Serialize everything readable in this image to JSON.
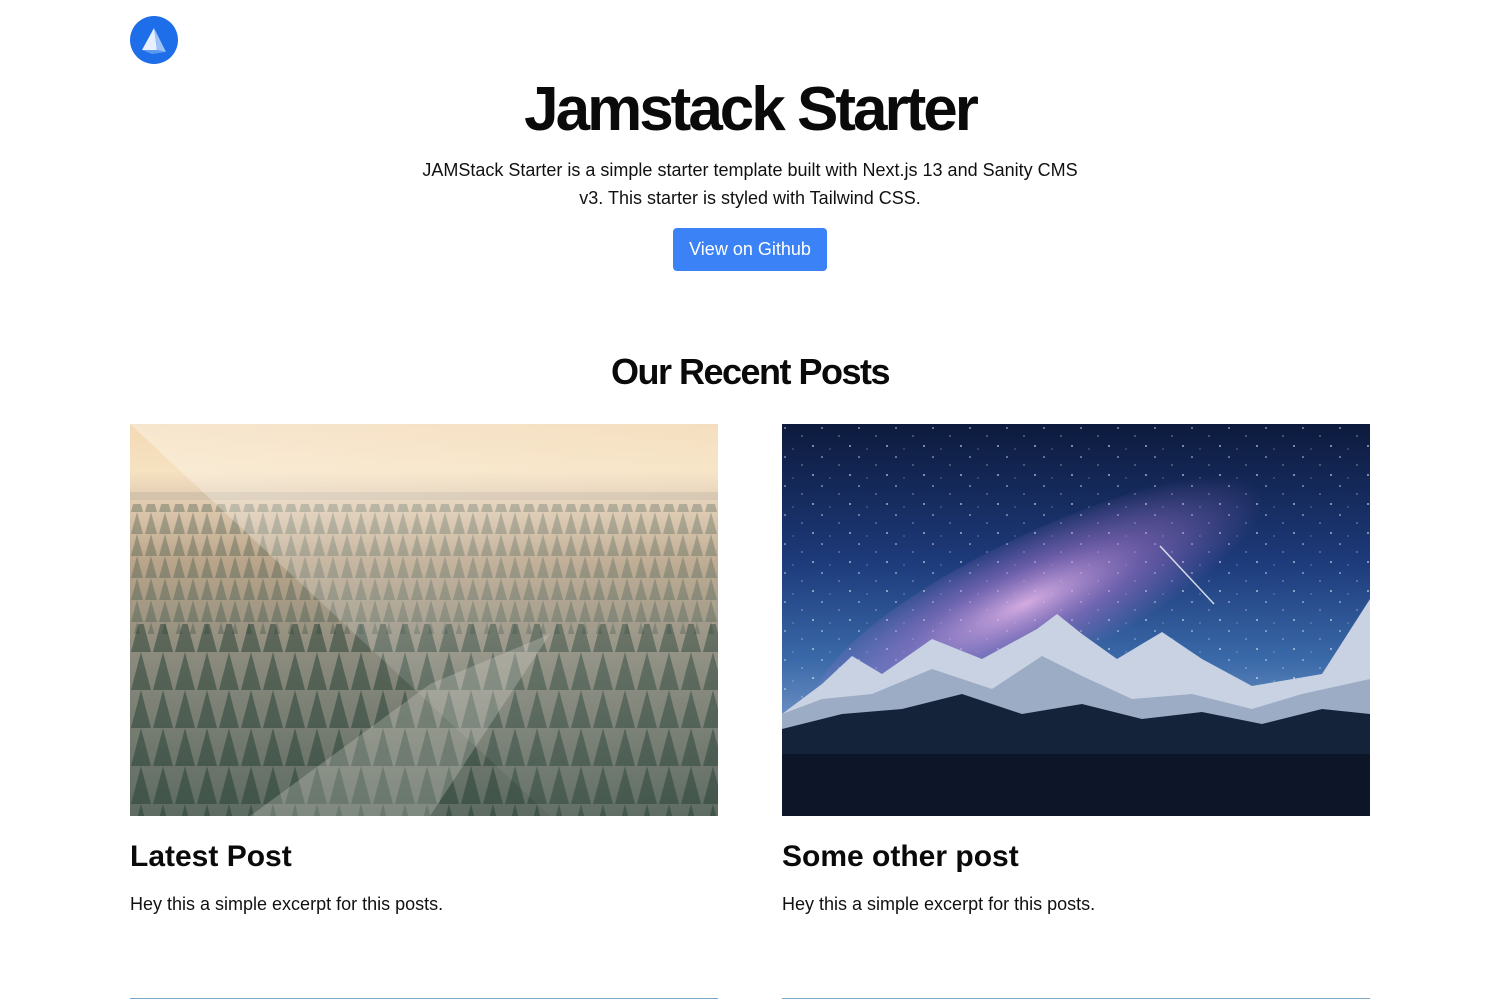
{
  "header": {
    "logo_icon": "sanity-sail-logo-icon",
    "brand_color": "#1d6ee8"
  },
  "hero": {
    "title": "Jamstack Starter",
    "description": "JAMStack Starter is a simple starter template built with Next.js 13 and Sanity CMS v3. This starter is styled with Tailwind CSS.",
    "button_label": "View on Github",
    "button_color": "#3b82f6"
  },
  "recent_posts": {
    "heading": "Our Recent Posts",
    "posts": [
      {
        "title": "Latest Post",
        "excerpt": "Hey this a simple excerpt for this posts.",
        "image": "misty-forest-sunrise-image"
      },
      {
        "title": "Some other post",
        "excerpt": "Hey this a simple excerpt for this posts.",
        "image": "milky-way-mountains-image"
      }
    ]
  }
}
